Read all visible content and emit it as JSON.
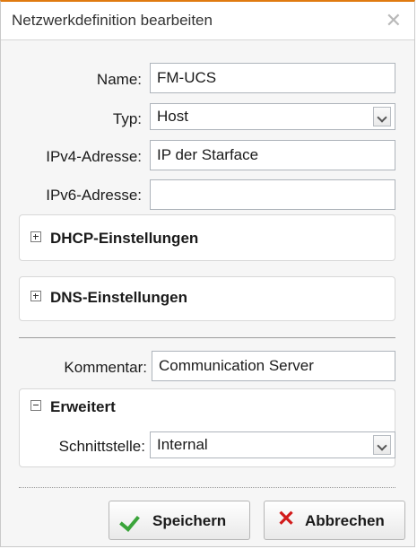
{
  "dialog": {
    "title": "Netzwerkdefinition bearbeiten",
    "close_glyph": "✕"
  },
  "form": {
    "name_label": "Name:",
    "name_value": "FM-UCS",
    "typ_label": "Typ:",
    "typ_value": "Host",
    "ipv4_label": "IPv4-Adresse:",
    "ipv4_value": "IP der Starface",
    "ipv6_label": "IPv6-Adresse:",
    "ipv6_value": ""
  },
  "sections": {
    "dhcp_label": "DHCP-Einstellungen",
    "dns_label": "DNS-Einstellungen",
    "erweitert_label": "Erweitert"
  },
  "kommentar": {
    "label": "Kommentar:",
    "value": "Communication Server"
  },
  "schnittstelle": {
    "label": "Schnittstelle:",
    "value": "Internal"
  },
  "buttons": {
    "save_label": "Speichern",
    "cancel_label": "Abbrechen"
  },
  "colors": {
    "accent": "#e07a10",
    "save_icon": "#3aa43a",
    "cancel_icon": "#d21b1b"
  }
}
